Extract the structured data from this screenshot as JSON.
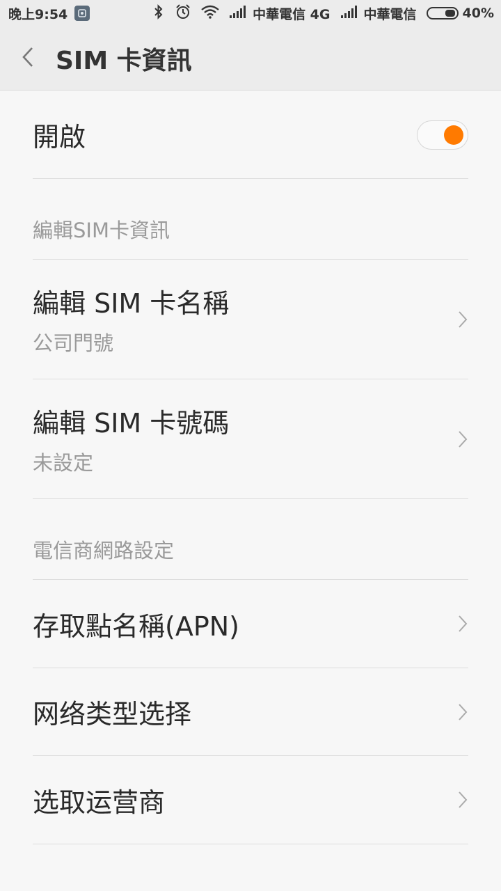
{
  "status_bar": {
    "time": "晚上9:54",
    "carrier1": "中華電信 4G",
    "carrier2": "中華電信",
    "battery": "40%",
    "battery_level": 0.4
  },
  "header": {
    "title": "SIM 卡資訊"
  },
  "enable_row": {
    "label": "開啟",
    "toggle_on": true,
    "toggle_color": "#ff7a00"
  },
  "section1": {
    "label": "編輯SIM卡資訊",
    "items": [
      {
        "label": "編輯 SIM 卡名稱",
        "value": "公司門號"
      },
      {
        "label": "編輯 SIM 卡號碼",
        "value": "未設定"
      }
    ]
  },
  "section2": {
    "label": "電信商網路設定",
    "items": [
      {
        "label": "存取點名稱(APN)"
      },
      {
        "label": "网络类型选择"
      },
      {
        "label": "选取运营商"
      }
    ]
  },
  "icons": {
    "notification": "notification-app-icon",
    "bluetooth": "bluetooth-icon",
    "alarm": "alarm-icon",
    "wifi": "wifi-icon",
    "signal": "signal-icon",
    "battery": "battery-icon",
    "back": "back-arrow-icon",
    "chevron": "chevron-right-icon"
  }
}
